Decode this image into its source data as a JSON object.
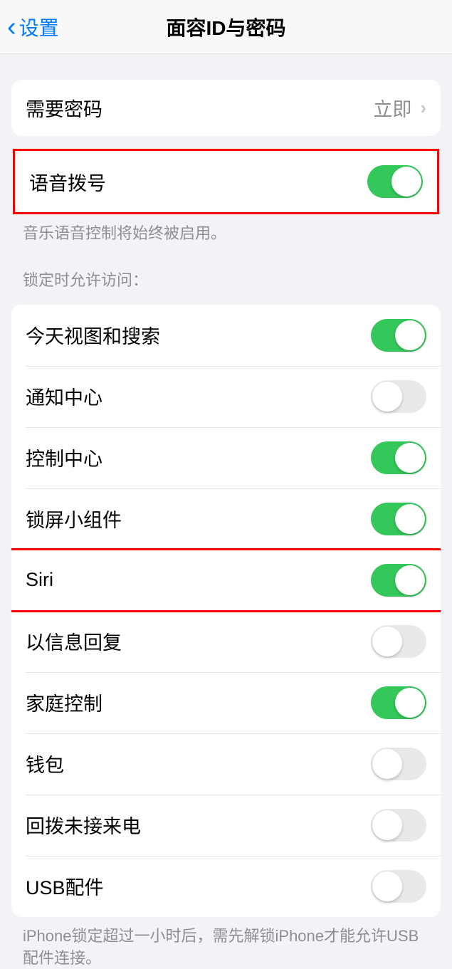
{
  "header": {
    "back_label": "设置",
    "title": "面容ID与密码"
  },
  "require_passcode": {
    "label": "需要密码",
    "value": "立即"
  },
  "voice_dial": {
    "label": "语音拨号",
    "footer": "音乐语音控制将始终被启用。",
    "enabled": true
  },
  "lock_access": {
    "header": "锁定时允许访问：",
    "items": [
      {
        "label": "今天视图和搜索",
        "enabled": true
      },
      {
        "label": "通知中心",
        "enabled": false
      },
      {
        "label": "控制中心",
        "enabled": true
      },
      {
        "label": "锁屏小组件",
        "enabled": true
      },
      {
        "label": "Siri",
        "enabled": true
      },
      {
        "label": "以信息回复",
        "enabled": false
      },
      {
        "label": "家庭控制",
        "enabled": true
      },
      {
        "label": "钱包",
        "enabled": false
      },
      {
        "label": "回拨未接来电",
        "enabled": false
      },
      {
        "label": "USB配件",
        "enabled": false
      }
    ],
    "footer": "iPhone锁定超过一小时后，需先解锁iPhone才能允许USB配件连接。"
  }
}
